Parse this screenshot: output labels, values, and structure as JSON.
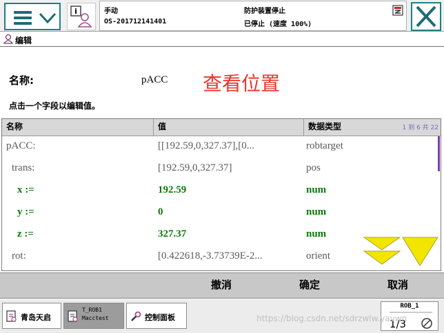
{
  "status": {
    "mode": "手动",
    "controller": "OS-201712141401",
    "safety": "防护装置停止",
    "state": "已停止 (速度 100%)"
  },
  "app": {
    "title": "编辑"
  },
  "name_label": "名称:",
  "name_value": "pACC",
  "annotation": "查看位置",
  "hint": "点击一个字段以编辑值。",
  "table": {
    "headers": [
      "名称",
      "值",
      "数据类型"
    ],
    "count_text": "1 到 6 共 22",
    "rows": [
      {
        "name": "pACC:",
        "value": "[[192.59,0,327.37],[0...",
        "type": "robtarget",
        "style": "grey"
      },
      {
        "name": " trans:",
        "value": "[192.59,0,327.37]",
        "type": "pos",
        "style": "grey"
      },
      {
        "name": "  x :=",
        "value": "192.59",
        "type": "num",
        "style": "green"
      },
      {
        "name": "  y :=",
        "value": "0",
        "type": "num",
        "style": "green"
      },
      {
        "name": "  z :=",
        "value": "327.37",
        "type": "num",
        "style": "green"
      },
      {
        "name": " rot:",
        "value": "[0.422618,-3.73739E-2...",
        "type": "orient",
        "style": "grey"
      }
    ]
  },
  "commands": {
    "undo": "撤消",
    "ok": "确定",
    "cancel": "取消"
  },
  "taskbar": {
    "items": [
      {
        "label": "青岛天启",
        "icon": "program-icon"
      },
      {
        "label_line1": "T_ROB1",
        "label_line2": "Macctest",
        "icon": "module-icon"
      },
      {
        "label": "控制面板",
        "icon": "wrench-icon"
      }
    ],
    "rob": {
      "label": "ROB_1",
      "fraction": "1/3"
    }
  },
  "watermark": "https://blog.csdn.net/sdrzwlw.yavwn",
  "colors": {
    "accent": "#1d7f86",
    "annotation": "#e8352a",
    "green_text": "#0b7a0b",
    "scroll_arrow": "#f2e600"
  }
}
